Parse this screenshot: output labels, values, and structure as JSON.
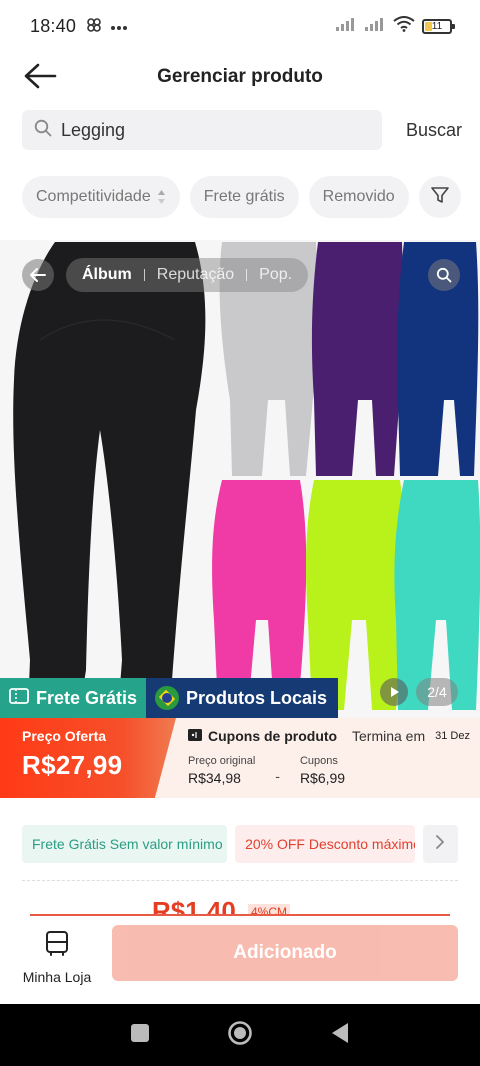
{
  "status_bar": {
    "time": "18:40",
    "battery_level": "11"
  },
  "header": {
    "title": "Gerenciar produto"
  },
  "search": {
    "value": "Legging",
    "button_label": "Buscar"
  },
  "filters": [
    {
      "label": "Competitividade"
    },
    {
      "label": "Frete grátis"
    },
    {
      "label": "Removido"
    }
  ],
  "gallery": {
    "tabs": [
      "Álbum",
      "Reputação",
      "Pop."
    ],
    "active_tab": "Álbum",
    "page_indicator": "2/4",
    "legging_colors": [
      "#1c1c1e",
      "#c9c9cc",
      "#4b1f6f",
      "#12347f",
      "#f03aa5",
      "#b8f21a",
      "#3fd8c0"
    ]
  },
  "badges": {
    "free_shipping": "Frete Grátis",
    "local_products": "Produtos Locais",
    "free_color": "#25a38b",
    "local_color": "#163a73"
  },
  "offer": {
    "offer_label": "Preço Oferta",
    "offer_price": "R$27,99",
    "coupons_title": "Cupons de produto",
    "ends_label": "Termina em",
    "ends_date": "31 Dez",
    "original_label": "Preço original",
    "original_value": "R$34,98",
    "separator": "-",
    "coupons_label": "Cupons",
    "coupons_value": "R$6,99"
  },
  "promos": {
    "free_shipping": "Frete Grátis Sem valor mínimo",
    "discount": "20% OFF Desconto máximo"
  },
  "partial": {
    "price": "R$1,40",
    "percent": "4%CM"
  },
  "bottom": {
    "my_store_label": "Minha Loja",
    "action_label": "Adicionado"
  },
  "colors": {
    "accent_red": "#f4461f",
    "button_disabled": "#f8b6aa"
  }
}
